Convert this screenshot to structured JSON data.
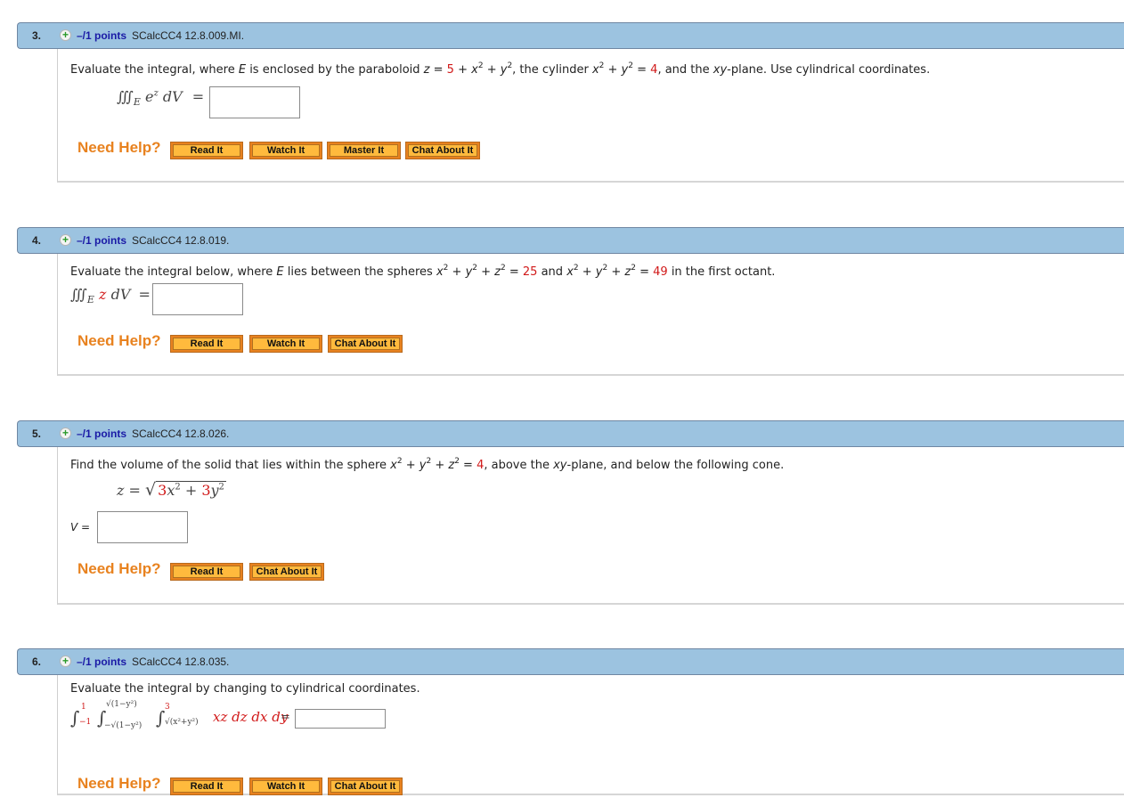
{
  "help_label": "Need Help?",
  "buttons": {
    "read": "Read It",
    "watch": "Watch It",
    "master": "Master It",
    "chat": "Chat About It"
  },
  "colors": {
    "header_bg": "#9cc3e0",
    "points": "#1a1aa6",
    "highlight": "#d11919",
    "help": "#e8821f",
    "button_fill": "#ffba3d"
  },
  "questions": [
    {
      "number": "3.",
      "points": "–/1 points",
      "code": "SCalcCC4 12.8.009.MI.",
      "text": [
        "Evaluate the integral, where ",
        "E",
        " is enclosed by the paraboloid ",
        "z",
        " = ",
        "5",
        " + ",
        "x",
        "2",
        " + ",
        "y",
        "2",
        ", the cylinder ",
        "x",
        "2",
        " + ",
        "y",
        "2",
        " = ",
        "4",
        ", and the ",
        "xy",
        "-plane. Use cylindrical coordinates."
      ],
      "formula": {
        "integral": "∭",
        "sub": "E",
        "integrand": "e",
        "exp": "z",
        "diff": " dV",
        "eq": "="
      },
      "answer_value": "",
      "help_buttons": [
        "Read It",
        "Watch It",
        "Master It",
        "Chat About It"
      ]
    },
    {
      "number": "4.",
      "points": "–/1 points",
      "code": "SCalcCC4 12.8.019.",
      "text": [
        "Evaluate the integral below, where ",
        "E",
        " lies between the spheres ",
        "x",
        "2",
        " + ",
        "y",
        "2",
        " + ",
        "z",
        "2",
        " = ",
        "25",
        " and ",
        "x",
        "2",
        " + ",
        "y",
        "2",
        " + ",
        "z",
        "2",
        " = ",
        "49",
        " in the first octant."
      ],
      "formula": {
        "integral": "∭",
        "sub": "E",
        "integrand": "z",
        "diff": " dV",
        "eq": "="
      },
      "answer_value": "",
      "help_buttons": [
        "Read It",
        "Watch It",
        "Chat About It"
      ]
    },
    {
      "number": "5.",
      "points": "–/1 points",
      "code": "SCalcCC4 12.8.026.",
      "text": [
        "Find the volume of the solid that lies within the sphere ",
        "x",
        "2",
        " + ",
        "y",
        "2",
        " + ",
        "z",
        "2",
        " = ",
        "4",
        ", above the ",
        "xy",
        "-plane, and below the following cone."
      ],
      "formula": {
        "lhs": "z =",
        "c1": "3",
        "t1": "x",
        "c2": "3",
        "t2": "y",
        "plus": "+",
        "exp": "2"
      },
      "answer_label": "V =",
      "answer_value": "",
      "help_buttons": [
        "Read It",
        "Chat About It"
      ]
    },
    {
      "number": "6.",
      "points": "–/1 points",
      "code": "SCalcCC4 12.8.035.",
      "text": [
        "Evaluate the integral by changing to cylindrical coordinates."
      ],
      "formula": {
        "outer": {
          "lower": "−1",
          "upper": "1"
        },
        "middle": {
          "lower": "−√(1−y²)",
          "upper": "√(1−y²)"
        },
        "inner": {
          "lower": "√(x²+y²)",
          "upper": "3"
        },
        "integrand": "xz dz dx dy",
        "eq": "="
      },
      "answer_value": "",
      "help_buttons": [
        "Read It",
        "Watch It",
        "Chat About It"
      ]
    }
  ]
}
